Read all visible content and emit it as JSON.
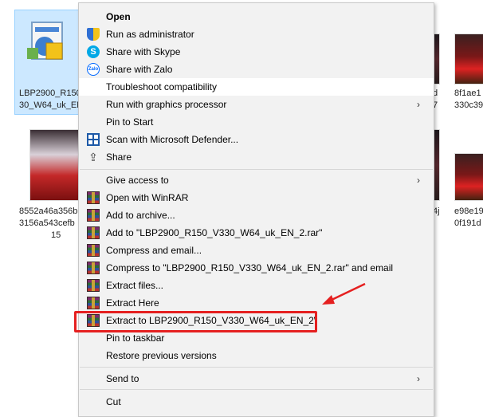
{
  "desktop": {
    "selected_file": {
      "line1": "LBP2900_R150",
      "line2": "30_W64_uk_EN"
    },
    "files_right_top": [
      {
        "line1": "d",
        "line2": "7"
      },
      {
        "line1": "8f1ae1",
        "line2": "330c39"
      }
    ],
    "file_left_bottom": {
      "line1": "8552a46a356b",
      "line2": "3156a543cefb",
      "line3": "15"
    },
    "files_right_bottom": [
      {
        "line1": "4j"
      },
      {
        "line1": "e98e19",
        "line2": "0f191d"
      }
    ]
  },
  "menu": {
    "items": [
      {
        "label": "Open",
        "icon": "none"
      },
      {
        "label": "Run as administrator",
        "icon": "uac-shield-icon"
      },
      {
        "label": "Share with Skype",
        "icon": "skype-icon"
      },
      {
        "label": "Share with Zalo",
        "icon": "zalo-icon",
        "icon_text": "Zalo"
      },
      {
        "label": "Troubleshoot compatibility",
        "icon": "none"
      },
      {
        "label": "Run with graphics processor",
        "icon": "none"
      },
      {
        "label": "Pin to Start",
        "icon": "none"
      },
      {
        "label": "Scan with Microsoft Defender...",
        "icon": "defender-icon"
      },
      {
        "label": "Share",
        "icon": "share-icon"
      },
      {
        "label": "Give access to",
        "icon": "none"
      },
      {
        "label": "Open with WinRAR",
        "icon": "winrar-icon"
      },
      {
        "label": "Add to archive...",
        "icon": "winrar-icon"
      },
      {
        "label": "Add to \"LBP2900_R150_V330_W64_uk_EN_2.rar\"",
        "icon": "winrar-icon"
      },
      {
        "label": "Compress and email...",
        "icon": "winrar-icon"
      },
      {
        "label": "Compress to \"LBP2900_R150_V330_W64_uk_EN_2.rar\" and email",
        "icon": "winrar-icon"
      },
      {
        "label": "Extract files...",
        "icon": "winrar-icon"
      },
      {
        "label": "Extract Here",
        "icon": "winrar-icon"
      },
      {
        "label": "Extract to LBP2900_R150_V330_W64_uk_EN_2\\",
        "icon": "winrar-icon"
      },
      {
        "label": "Pin to taskbar",
        "icon": "none"
      },
      {
        "label": "Restore previous versions",
        "icon": "none"
      },
      {
        "label": "Send to",
        "icon": "none"
      },
      {
        "label": "Cut",
        "icon": "none"
      }
    ],
    "submenu_arrow": "›",
    "share_glyph": "⇪",
    "skype_glyph": "S"
  },
  "colors": {
    "highlight": "#e52020",
    "hover_row": "#ffffff",
    "selection": "#cce8ff"
  }
}
